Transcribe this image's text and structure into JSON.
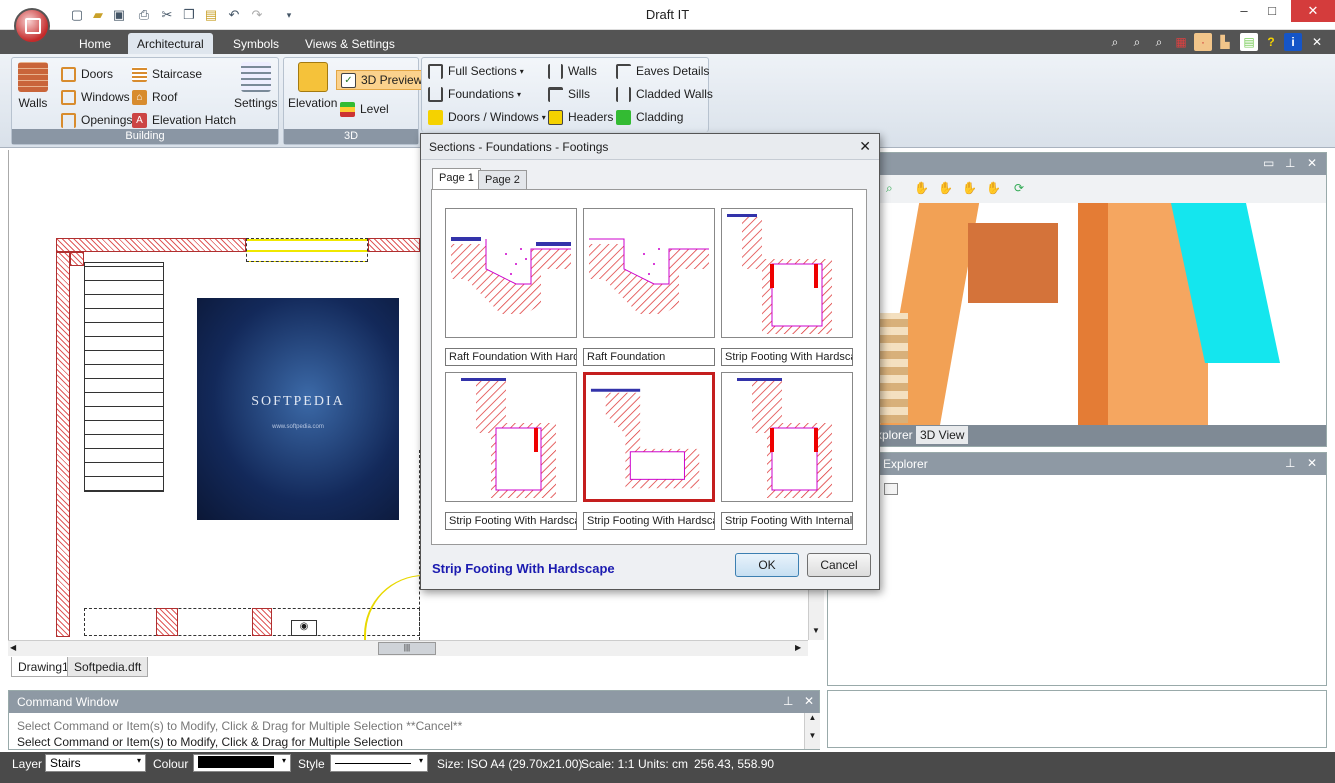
{
  "window": {
    "title": "Draft IT"
  },
  "tabs": [
    "Home",
    "Architectural",
    "Symbols",
    "Views & Settings"
  ],
  "active_tab": "Architectural",
  "ribbon": {
    "building": {
      "label": "Building",
      "walls": "Walls",
      "doors": "Doors",
      "windows": "Windows",
      "openings": "Openings",
      "staircase": "Staircase",
      "roof": "Roof",
      "elevation_hatch": "Elevation Hatch",
      "settings": "Settings"
    },
    "threed": {
      "label": "3D",
      "elevation": "Elevation",
      "preview": "3D Preview",
      "level": "Level"
    },
    "sections": {
      "full_sections": "Full Sections",
      "foundations": "Foundations",
      "doors_windows": "Doors / Windows",
      "walls": "Walls",
      "sills": "Sills",
      "headers": "Headers",
      "eaves_details": "Eaves Details",
      "cladded_walls": "Cladded Walls",
      "cladding": "Cladding"
    }
  },
  "canvas": {
    "watermark": "SOFTPEDIA",
    "watermark_url": "www.softpedia.com"
  },
  "doc_tabs": [
    "Drawing1",
    "Softpedia.dft"
  ],
  "command_window": {
    "title": "Command Window",
    "lines": [
      "Select Command or Item(s) to Modify, Click & Drag for Multiple Selection  **Cancel**",
      "Select Command or Item(s) to Modify, Click & Drag for Multiple Selection"
    ]
  },
  "right_panel": {
    "tabs": [
      "xplorer",
      "3D View"
    ],
    "explorer_title": "Explorer"
  },
  "status_bar": {
    "layer_label": "Layer",
    "layer_value": "Stairs",
    "colour_label": "Colour",
    "style_label": "Style",
    "size": "Size: ISO A4 (29.70x21.00)",
    "scale": "Scale: 1:1",
    "units": "Units: cm",
    "coords": "256.43, 558.90"
  },
  "dialog": {
    "title": "Sections - Foundations - Footings",
    "tabs": [
      "Page 1",
      "Page 2"
    ],
    "items": [
      "Raft Foundation With Hardscape",
      "Raft Foundation",
      "Strip Footing With Hardscape",
      "Strip Footing With Hardscape",
      "Strip Footing With Hardscape",
      "Strip Footing With Internal"
    ],
    "selected_name": "Strip Footing With Hardscape",
    "ok": "OK",
    "cancel": "Cancel"
  },
  "colors": {
    "accent": "#c41e1e",
    "tab_bar": "#545454",
    "selected_text": "#1b1bb0"
  }
}
